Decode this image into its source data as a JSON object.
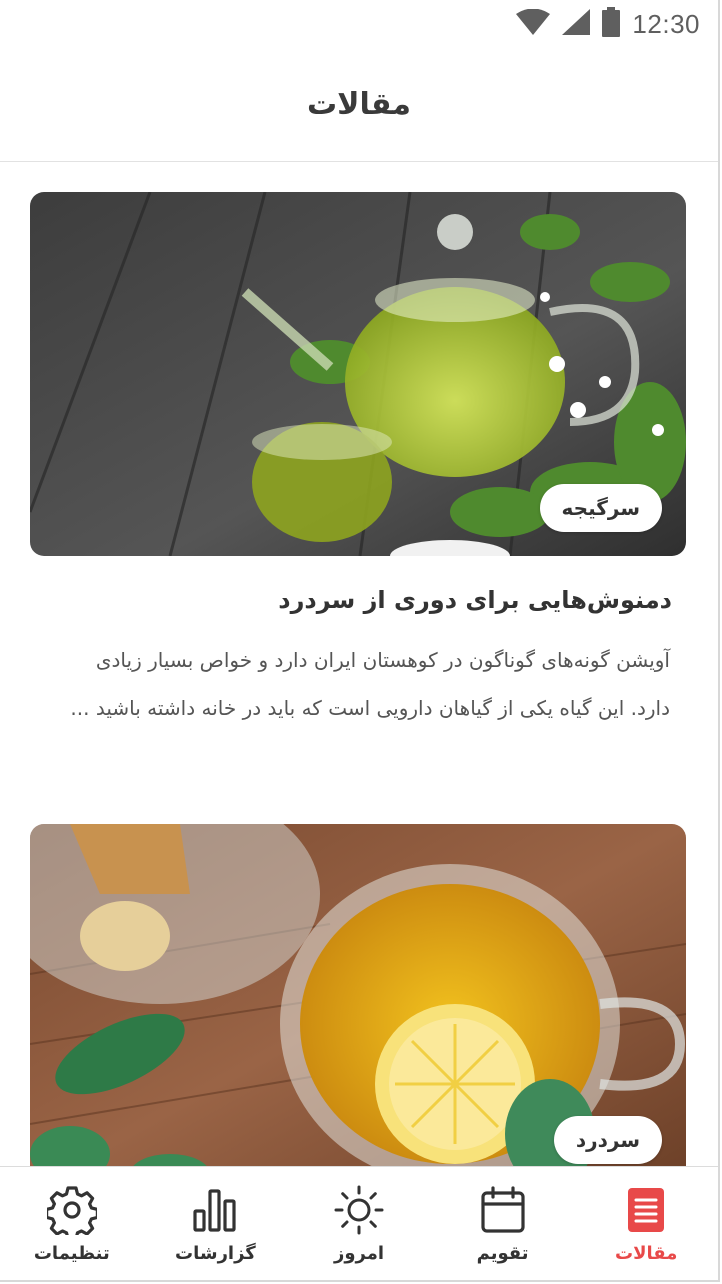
{
  "status_bar": {
    "time": "12:30",
    "icons": [
      "wifi-icon",
      "cell-signal-icon",
      "battery-icon"
    ]
  },
  "header": {
    "title": "مقالات"
  },
  "articles": [
    {
      "tag": "سرگیجه",
      "title": "دمنوش‌هایی برای دوری از سردرد",
      "excerpt": "آویشن گونه‌های گوناگون در کوهستان ایران دارد و خواص بسیار زیادی دارد. این گیاه یکی از گیاهان دارویی است که باید در خانه داشته باشید ...",
      "image": "glass-teapot-with-herbs"
    },
    {
      "tag": "سردرد",
      "image": "lemon-ginger-tea-cup"
    }
  ],
  "bottom_nav": [
    {
      "label": "تنظیمات",
      "icon": "gear-icon"
    },
    {
      "label": "گزارشات",
      "icon": "bar-chart-icon"
    },
    {
      "label": "امروز",
      "icon": "sun-icon"
    },
    {
      "label": "تقویم",
      "icon": "calendar-icon"
    },
    {
      "label": "مقالات",
      "icon": "document-icon",
      "active": true
    }
  ],
  "colors": {
    "accent": "#e84949",
    "text": "#333333",
    "divider": "#e2e2e2"
  }
}
